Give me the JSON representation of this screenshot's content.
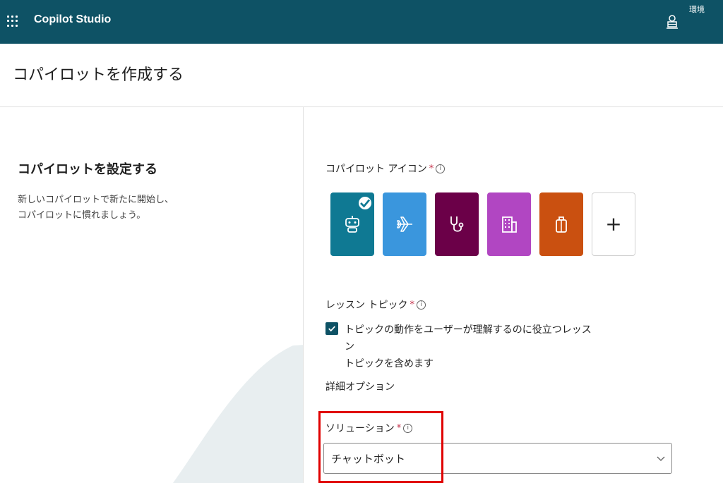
{
  "app": {
    "title": "Copilot Studio"
  },
  "header": {
    "environment_label": "環境"
  },
  "page": {
    "title": "コパイロットを作成する"
  },
  "left_panel": {
    "heading": "コパイロットを設定する",
    "description_line1": "新しいコパイロットで新たに開始し、",
    "description_line2": "コパイロットに慣れましょう。"
  },
  "form": {
    "icon_field": {
      "label": "コパイロット アイコン",
      "required_mark": "*",
      "info_glyph": "i",
      "options": [
        {
          "icon": "bot-icon",
          "color": "#0f7993",
          "selected": true
        },
        {
          "icon": "airplane-icon",
          "color": "#3a96dd",
          "selected": false
        },
        {
          "icon": "stethoscope-icon",
          "color": "#6b0048",
          "selected": false
        },
        {
          "icon": "building-icon",
          "color": "#b146c2",
          "selected": false
        },
        {
          "icon": "briefcase-icon",
          "color": "#ca5010",
          "selected": false
        },
        {
          "icon": "plus-icon",
          "color": "#ffffff",
          "selected": false
        }
      ],
      "add_glyph": "+"
    },
    "lesson_topics": {
      "label": "レッスン トピック",
      "required_mark": "*",
      "info_glyph": "i",
      "checked": true,
      "checkbox_line1": "トピックの動作をユーザーが理解するのに役立つレッスン",
      "checkbox_line2": "トピックを含めます"
    },
    "advanced_options": {
      "title": "詳細オプション"
    },
    "solution": {
      "label": "ソリューション",
      "required_mark": "*",
      "info_glyph": "i",
      "selected_value": "チャットボット"
    }
  },
  "colors": {
    "topbar": "#0e5265",
    "highlight": "#e00000",
    "required": "#c4314b"
  }
}
